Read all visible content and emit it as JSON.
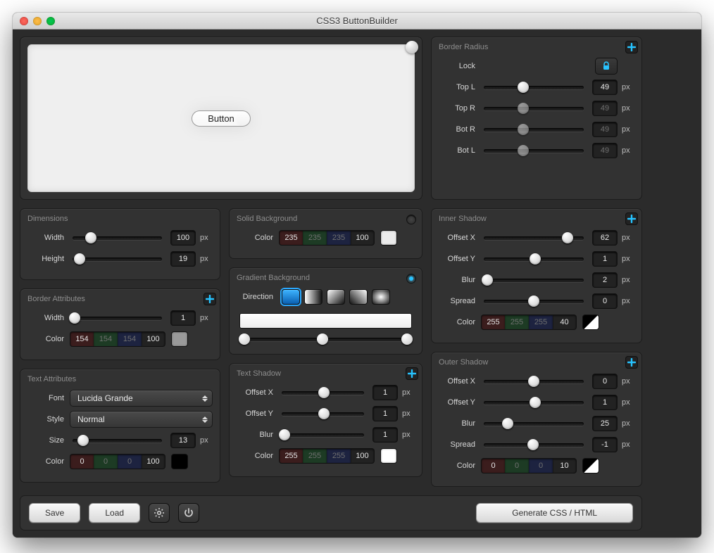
{
  "window": {
    "title": "CSS3 ButtonBuilder"
  },
  "preview": {
    "button_label": "Button"
  },
  "dimensions": {
    "title": "Dimensions",
    "width_label": "Width",
    "width_value": "100",
    "width_unit": "px",
    "height_label": "Height",
    "height_value": "19",
    "height_unit": "px"
  },
  "border_attr": {
    "title": "Border Attributes",
    "width_label": "Width",
    "width_value": "1",
    "width_unit": "px",
    "color_label": "Color",
    "color": {
      "r": "154",
      "g": "154",
      "b": "154",
      "a": "100",
      "hex": "#9a9a9a"
    }
  },
  "text_attr": {
    "title": "Text Attributes",
    "font_label": "Font",
    "font_value": "Lucida Grande",
    "style_label": "Style",
    "style_value": "Normal",
    "size_label": "Size",
    "size_value": "13",
    "size_unit": "px",
    "color_label": "Color",
    "color": {
      "r": "0",
      "g": "0",
      "b": "0",
      "a": "100",
      "hex": "#000000"
    }
  },
  "solid_bg": {
    "title": "Solid Background",
    "color_label": "Color",
    "color": {
      "r": "235",
      "g": "235",
      "b": "235",
      "a": "100",
      "hex": "#ebebeb"
    },
    "selected": false
  },
  "gradient_bg": {
    "title": "Gradient Background",
    "direction_label": "Direction",
    "selected": true,
    "stops": [
      0,
      48,
      100
    ]
  },
  "text_shadow": {
    "title": "Text Shadow",
    "offset_x_label": "Offset X",
    "offset_x": "1",
    "offset_y_label": "Offset Y",
    "offset_y": "1",
    "blur_label": "Blur",
    "blur": "1",
    "color_label": "Color",
    "color": {
      "r": "255",
      "g": "255",
      "b": "255",
      "a": "100",
      "hex": "#ffffff"
    },
    "unit": "px"
  },
  "border_radius": {
    "title": "Border Radius",
    "lock_label": "Lock",
    "locked": true,
    "tl_label": "Top L",
    "tl": "49",
    "tr_label": "Top R",
    "tr": "49",
    "br_label": "Bot R",
    "br": "49",
    "bl_label": "Bot L",
    "bl": "49",
    "unit": "px"
  },
  "inner_shadow": {
    "title": "Inner Shadow",
    "offset_x_label": "Offset X",
    "offset_x": "62",
    "offset_y_label": "Offset Y",
    "offset_y": "1",
    "blur_label": "Blur",
    "blur": "2",
    "spread_label": "Spread",
    "spread": "0",
    "color_label": "Color",
    "color": {
      "r": "255",
      "g": "255",
      "b": "255",
      "a": "40"
    },
    "unit": "px"
  },
  "outer_shadow": {
    "title": "Outer Shadow",
    "offset_x_label": "Offset X",
    "offset_x": "0",
    "offset_y_label": "Offset Y",
    "offset_y": "1",
    "blur_label": "Blur",
    "blur": "25",
    "spread_label": "Spread",
    "spread": "-1",
    "color_label": "Color",
    "color": {
      "r": "0",
      "g": "0",
      "b": "0",
      "a": "10"
    },
    "unit": "px"
  },
  "bottom": {
    "save": "Save",
    "load": "Load",
    "generate": "Generate CSS / HTML"
  }
}
